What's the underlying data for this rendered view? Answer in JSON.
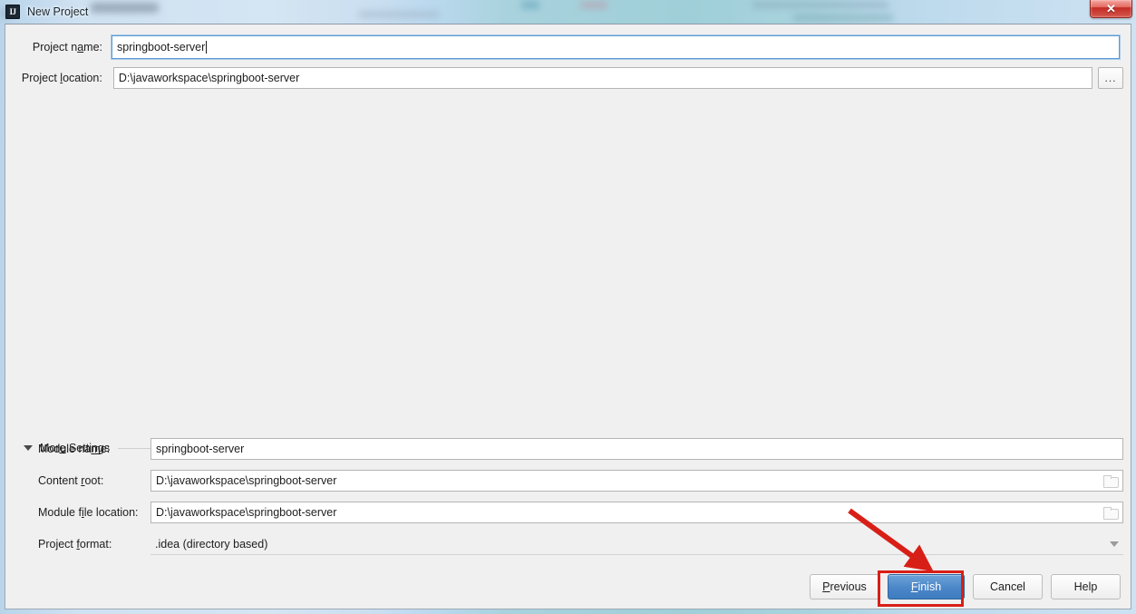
{
  "window": {
    "title": "New Project",
    "app_icon": "IJ",
    "close_label": "✕"
  },
  "fields": {
    "project_name": {
      "label_before": "Project n",
      "label_mnemonic": "a",
      "label_after": "me:",
      "value": "springboot-server",
      "focused": true
    },
    "project_location": {
      "label_before": "Project ",
      "label_mnemonic": "l",
      "label_after": "ocation:",
      "value": "D:\\javaworkspace\\springboot-server",
      "browse_label": "..."
    }
  },
  "more_settings": {
    "label_before": "Mor",
    "label_mnemonic": "e",
    "label_after": " Settings",
    "expanded": true,
    "fields": {
      "module_name": {
        "label_before": "Module na",
        "label_mnemonic": "m",
        "label_after": "e:",
        "value": "springboot-server"
      },
      "content_root": {
        "label_before": "Content ",
        "label_mnemonic": "r",
        "label_after": "oot:",
        "value": "D:\\javaworkspace\\springboot-server"
      },
      "module_file_location": {
        "label_before": "Module f",
        "label_mnemonic": "i",
        "label_after": "le location:",
        "value": "D:\\javaworkspace\\springboot-server"
      },
      "project_format": {
        "label_before": "Project ",
        "label_mnemonic": "f",
        "label_after": "ormat:",
        "value": ".idea (directory based)"
      }
    }
  },
  "footer": {
    "previous": {
      "before": "",
      "mnemonic": "P",
      "after": "revious"
    },
    "finish": {
      "before": "",
      "mnemonic": "F",
      "after": "inish"
    },
    "cancel": {
      "before": "Cancel",
      "mnemonic": "",
      "after": ""
    },
    "help": {
      "before": "Help",
      "mnemonic": "",
      "after": ""
    }
  },
  "annotations": {
    "highlight_color": "#d81f17",
    "arrow_color": "#d81f17"
  }
}
